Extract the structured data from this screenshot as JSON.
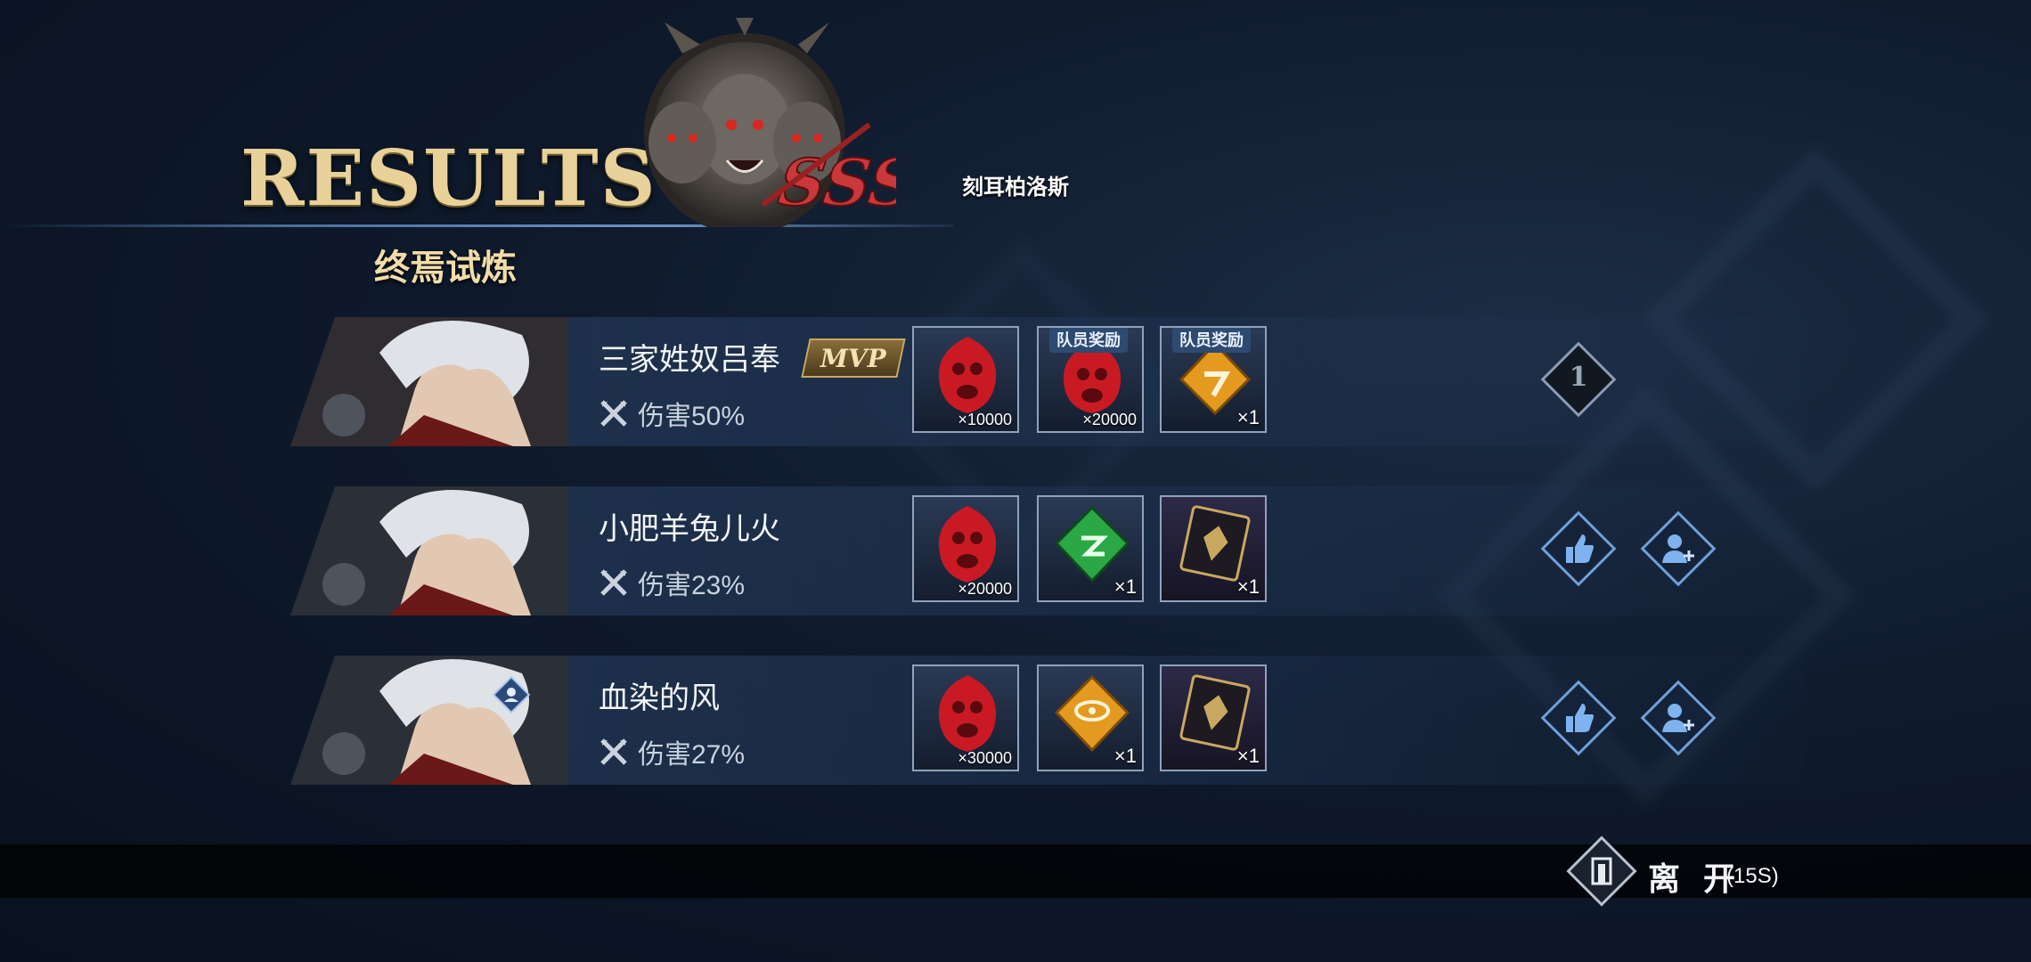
{
  "header": {
    "title": "RESULTS",
    "subtitle": "终焉试炼",
    "boss_name": "刻耳柏洛斯",
    "boss_rank": "SSS"
  },
  "players": [
    {
      "name": "三家姓奴吕奉",
      "mvp_label": "MVP",
      "damage_label": "伤害50%",
      "rank": "1",
      "rewards": [
        {
          "icon": "red-orb-icon",
          "qty": "×10000",
          "tag": ""
        },
        {
          "icon": "red-orb-icon",
          "qty": "×20000",
          "tag": "队员奖励"
        },
        {
          "icon": "orange-crystal-icon",
          "qty": "×1",
          "tag": "队员奖励"
        }
      ]
    },
    {
      "name": "小肥羊兔儿火",
      "damage_label": "伤害23%",
      "rewards": [
        {
          "icon": "red-orb-icon",
          "qty": "×20000"
        },
        {
          "icon": "green-crystal-icon",
          "qty": "×1"
        },
        {
          "icon": "demon-card-icon",
          "qty": "×1"
        }
      ]
    },
    {
      "name": "血染的风",
      "damage_label": "伤害27%",
      "rewards": [
        {
          "icon": "red-orb-icon",
          "qty": "×30000"
        },
        {
          "icon": "orange-crystal-icon",
          "qty": "×1"
        },
        {
          "icon": "demon-card-icon",
          "qty": "×1"
        }
      ]
    }
  ],
  "footer": {
    "leave_label": "离 开",
    "timer": "(15S)"
  },
  "colors": {
    "accent_gold": "#e8d29a",
    "action_blue": "#6fa0d8",
    "row_bg": "#263c5c"
  }
}
